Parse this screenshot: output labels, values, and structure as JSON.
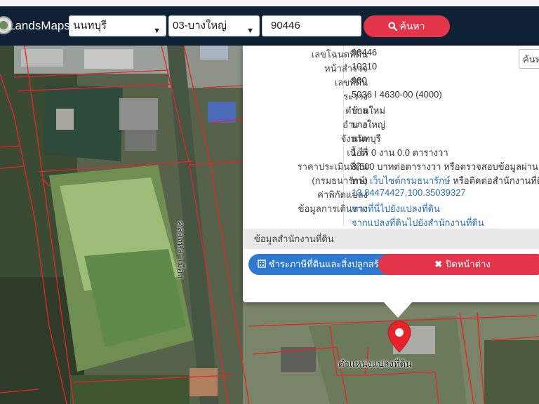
{
  "app": {
    "brand": "LandsMaps"
  },
  "search": {
    "province": "นนทบุรี",
    "district": "03-บางใหญ่",
    "parcel_no": "90446",
    "button_label": "ค้นหา"
  },
  "popup": {
    "search_placeholder": "ค้นห",
    "rows": [
      {
        "key": "เลขโฉนดที่ดิน",
        "value": "90446"
      },
      {
        "key": "หน้าสำรวจ",
        "value": "10210"
      },
      {
        "key": "เลขที่ดิน",
        "value": "900"
      },
      {
        "key": "ระวาง",
        "value": "5036 I 4630-00 (4000)"
      },
      {
        "key": "ตำบล",
        "value": "บ้านใหม่"
      },
      {
        "key": "อำเภอ",
        "value": "บางใหญ่"
      },
      {
        "key": "จังหวัด",
        "value": "นนทบุรี"
      },
      {
        "key": "เนื้อที่",
        "value": "1 ไร่ 0 งาน 0.0 ตารางวา"
      },
      {
        "key": "ราคาประเมินที่ดิน",
        "value": "3,500 บาทต่อตารางวา หรือตรวจสอบข้อมูลผ่าน"
      },
      {
        "key": "(กรมธนารักษ์)",
        "value_prefix": "ทาง",
        "value_link": "เว็บไซต์กรมธนารักษ์",
        "value_suffix": "หรือติดต่อสำนักงานที่ดิ"
      },
      {
        "key": "ค่าพิกัดแปลง",
        "value": "13.84474427,100.35039327"
      },
      {
        "key": "ข้อมูลการเดินทาง",
        "value": "จากที่นี่ไปยังแปลงที่ดิน"
      },
      {
        "key": "",
        "value": "จากแปลงที่ดินไปยังสำนักงานที่ดิน"
      }
    ],
    "section_title": "ข้อมูลสำนักงานที่ดิน",
    "tax_button": "ชำระภาษีที่ดินและสิ่งปลูกสร้าง",
    "close_button": "ปิดหน้าต่าง"
  },
  "map": {
    "road_label": "คลองหลาเมือง",
    "pin_label": "ตำแหน่งแปลงที่ดิน",
    "colors": {
      "parcel_line": "#e8232b",
      "pin": "#e8232b",
      "navbar": "#0f2134",
      "accent_red": "#e23549",
      "accent_blue": "#2f78d0"
    }
  }
}
